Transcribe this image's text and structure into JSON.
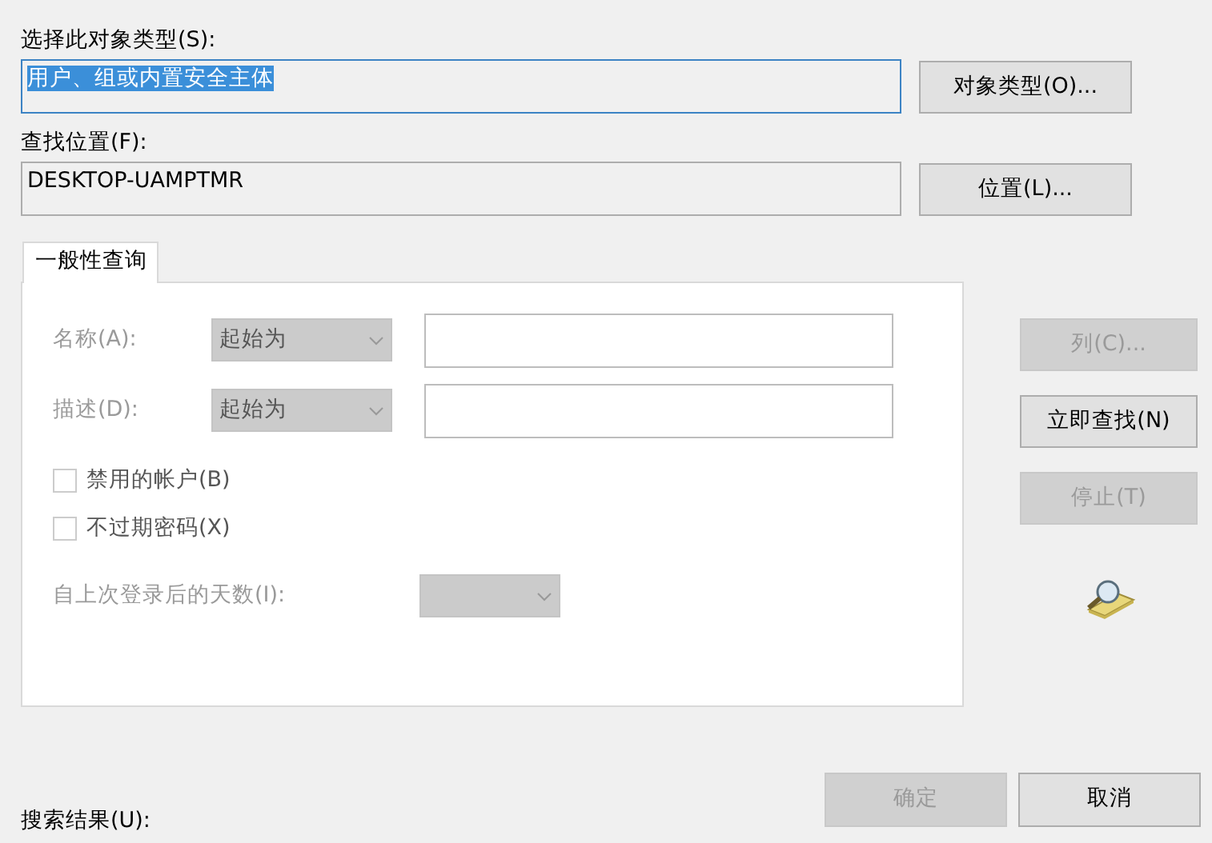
{
  "object_type": {
    "label": "选择此对象类型(S):",
    "value": "用户、组或内置安全主体",
    "selected": true,
    "button": "对象类型(O)..."
  },
  "location": {
    "label": "查找位置(F):",
    "value": "DESKTOP-UAMPTMR",
    "selected": false,
    "button": "位置(L)..."
  },
  "tabs": [
    {
      "label": "一般性查询",
      "selected": true
    }
  ],
  "query_rows": [
    {
      "label": "名称(A):",
      "match": "起始为",
      "disabled": true
    },
    {
      "label": "描述(D):",
      "match": "起始为",
      "disabled": true
    }
  ],
  "checkboxes": [
    {
      "label": "禁用的帐户(B)",
      "checked": false
    },
    {
      "label": "不过期密码(X)",
      "checked": false
    }
  ],
  "days": {
    "label": "自上次登录后的天数(I):",
    "disabled": true
  },
  "side_buttons": [
    {
      "label": "列(C)...",
      "disabled": true
    },
    {
      "label": "立即查找(N)",
      "disabled": false
    },
    {
      "label": "停止(T)",
      "disabled": true
    }
  ],
  "dialog_buttons": [
    {
      "label": "确定",
      "disabled": true
    },
    {
      "label": "取消",
      "disabled": false
    }
  ],
  "results_label": "搜索结果(U):"
}
